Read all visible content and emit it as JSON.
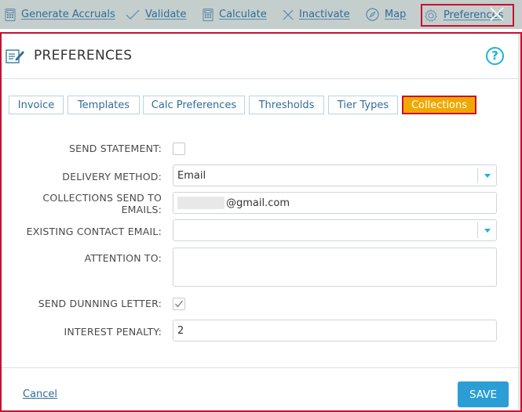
{
  "toolbar": {
    "items": [
      {
        "label": "Generate Accruals",
        "icon": "calculator-icon"
      },
      {
        "label": "Validate",
        "icon": "checkmark-icon"
      },
      {
        "label": "Calculate",
        "icon": "calculator-icon"
      },
      {
        "label": "Inactivate",
        "icon": "x-icon"
      },
      {
        "label": "Map",
        "icon": "compass-icon"
      },
      {
        "label": "Preferences",
        "icon": "gear-icon"
      }
    ]
  },
  "dialog": {
    "title": "PREFERENCES",
    "help_label": "?",
    "tabs": [
      {
        "label": "Invoice",
        "active": false
      },
      {
        "label": "Templates",
        "active": false
      },
      {
        "label": "Calc Preferences",
        "active": false
      },
      {
        "label": "Thresholds",
        "active": false
      },
      {
        "label": "Tier Types",
        "active": false
      },
      {
        "label": "Collections",
        "active": true
      }
    ],
    "form": {
      "send_statement_label": "SEND STATEMENT:",
      "send_statement_checked": false,
      "delivery_method_label": "DELIVERY METHOD:",
      "delivery_method_value": "Email",
      "collections_send_label_line1": "COLLECTIONS SEND TO",
      "collections_send_label_line2": "EMAILS:",
      "collections_send_value": "@gmail.com",
      "existing_contact_label": "EXISTING CONTACT EMAIL:",
      "existing_contact_value": "",
      "attention_label": "ATTENTION TO:",
      "attention_value": "",
      "send_dunning_label": "SEND DUNNING LETTER:",
      "send_dunning_checked": true,
      "interest_penalty_label": "INTEREST PENALTY:",
      "interest_penalty_value": "2"
    },
    "footer": {
      "cancel_label": "Cancel",
      "save_label": "SAVE"
    }
  },
  "colors": {
    "toolbar_bg": "#c4cecd",
    "link": "#2f6d98",
    "accent_active_tab": "#f0a800",
    "highlight_border": "#c8102e",
    "help_cyan": "#1bb3d4",
    "save_button": "#2b9ed6"
  }
}
